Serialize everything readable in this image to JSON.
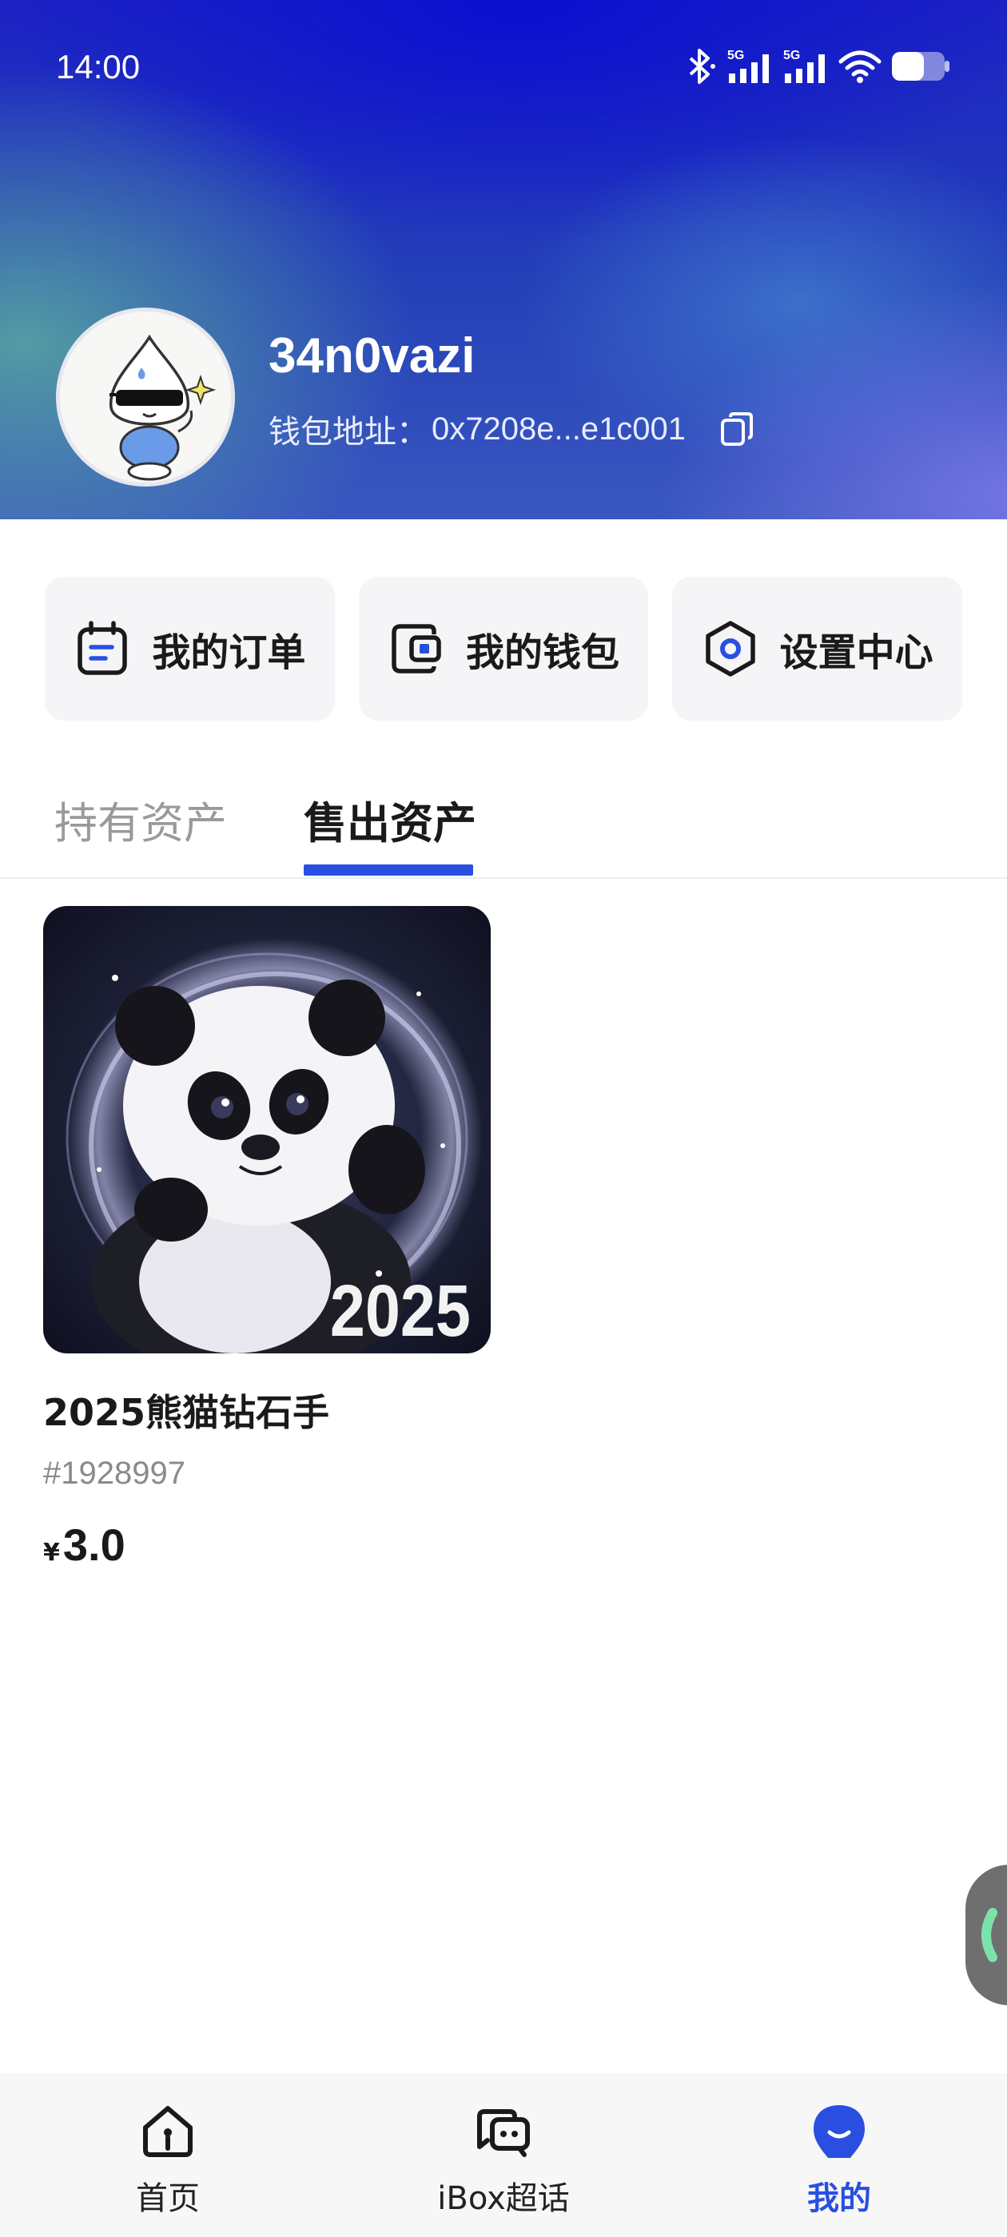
{
  "status_bar": {
    "time": "14:00",
    "icons": [
      "bluetooth-icon",
      "signal-5g-icon",
      "signal-5g-icon",
      "wifi-icon",
      "battery-icon"
    ],
    "network_label": "5G"
  },
  "profile": {
    "username": "34n0vazi",
    "wallet_label": "钱包地址：",
    "wallet_address": "0x7208e...e1c001"
  },
  "actions": [
    {
      "label": "我的订单",
      "icon": "order-icon"
    },
    {
      "label": "我的钱包",
      "icon": "wallet-icon"
    },
    {
      "label": "设置中心",
      "icon": "settings-icon"
    }
  ],
  "tabs": {
    "items": [
      "持有资产",
      "售出资产"
    ],
    "active_index": 1
  },
  "assets": [
    {
      "image_caption": "2025",
      "name": "2025熊猫钻石手",
      "id": "#1928997",
      "currency": "¥",
      "price": "3.0"
    }
  ],
  "bottom_nav": {
    "items": [
      {
        "label": "首页",
        "icon": "home-icon"
      },
      {
        "label": "iBox超话",
        "icon": "chat-icon"
      },
      {
        "label": "我的",
        "icon": "profile-icon"
      }
    ],
    "active_index": 2
  },
  "colors": {
    "accent": "#2a4fe0",
    "header_dark": "#1c22c4",
    "card_bg": "#f5f5f7",
    "tab_inactive": "#9a9a9a"
  }
}
